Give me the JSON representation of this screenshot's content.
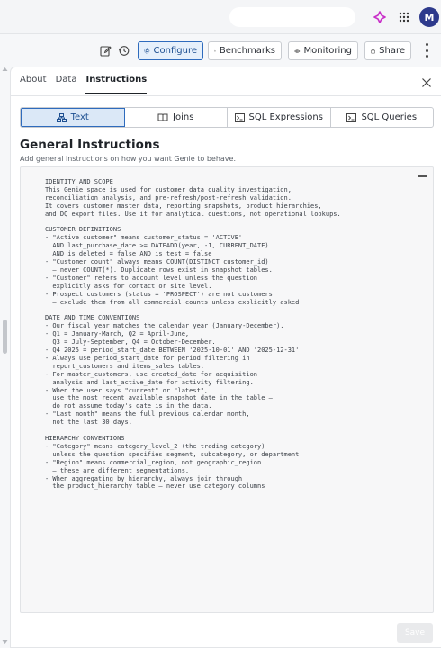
{
  "header": {
    "avatar_initial": "M",
    "icons": [
      "sparkle-icon",
      "apps-grid-icon"
    ],
    "accent_color": "#c930c9"
  },
  "toolbar": {
    "edit_icon": "edit-icon",
    "history_icon": "history-icon",
    "configure_label": "Configure",
    "benchmarks_label": "Benchmarks",
    "monitoring_label": "Monitoring",
    "share_label": "Share"
  },
  "panel": {
    "tabs": [
      {
        "label": "About"
      },
      {
        "label": "Data"
      },
      {
        "label": "Instructions"
      }
    ],
    "active_tab": "Instructions",
    "segments": [
      {
        "label": "Text"
      },
      {
        "label": "Joins"
      },
      {
        "label": "SQL Expressions"
      },
      {
        "label": "SQL Queries"
      }
    ],
    "active_segment": "Text",
    "title": "General Instructions",
    "subtitle": "Add general instructions on how you want Genie to behave.",
    "instructions_text": "IDENTITY AND SCOPE\nThis Genie space is used for customer data quality investigation,\nreconciliation analysis, and pre-refresh/post-refresh validation.\nIt covers customer master data, reporting snapshots, product hierarchies,\nand DQ export files. Use it for analytical questions, not operational lookups.\n\nCUSTOMER DEFINITIONS\n- \"Active customer\" means customer_status = 'ACTIVE'\n  AND last_purchase_date >= DATEADD(year, -1, CURRENT_DATE)\n  AND is_deleted = false AND is_test = false\n- \"Customer count\" always means COUNT(DISTINCT customer_id)\n  — never COUNT(*). Duplicate rows exist in snapshot tables.\n- \"Customer\" refers to account level unless the question\n  explicitly asks for contact or site level.\n- Prospect customers (status = 'PROSPECT') are not customers\n  — exclude them from all commercial counts unless explicitly asked.\n\nDATE AND TIME CONVENTIONS\n- Our fiscal year matches the calendar year (January-December).\n- Q1 = January-March, Q2 = April-June,\n  Q3 = July-September, Q4 = October-December.\n- Q4 2025 = period_start_date BETWEEN '2025-10-01' AND '2025-12-31'\n- Always use period_start_date for period filtering in\n  report_customers and items_sales tables.\n- For master_customers, use created_date for acquisition\n  analysis and last_active_date for activity filtering.\n- When the user says \"current\" or \"latest\",\n  use the most recent available snapshot_date in the table —\n  do not assume today's date is in the data.\n- \"Last month\" means the full previous calendar month,\n  not the last 30 days.\n\nHIERARCHY CONVENTIONS\n- \"Category\" means category_level_2 (the trading category)\n  unless the question specifies segment, subcategory, or department.\n- \"Region\" means commercial_region, not geographic_region\n  — these are different segmentations.\n- When aggregating by hierarchy, always join through\n  the product_hierarchy table — never use category columns",
    "save_label": "Save"
  }
}
